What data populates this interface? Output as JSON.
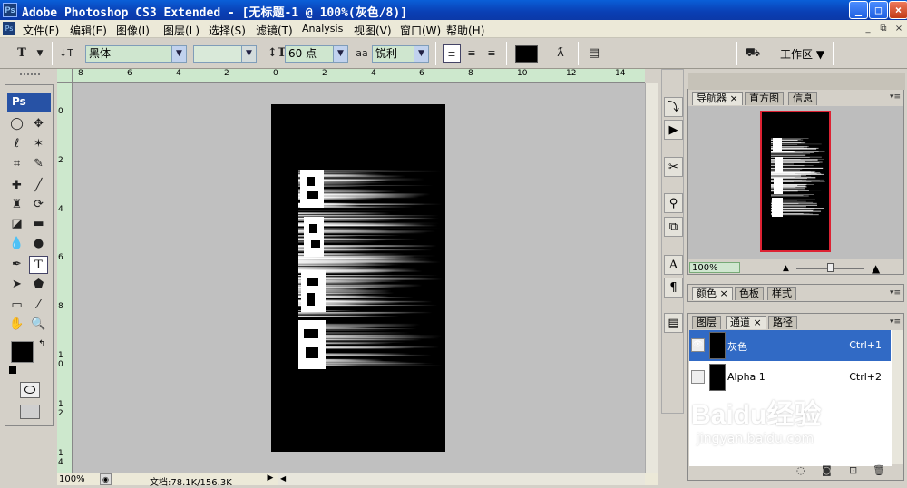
{
  "window": {
    "title": "Adobe Photoshop CS3 Extended - [无标题-1 @ 100%(灰色/8)]",
    "app_icon": "Ps",
    "controls": [
      "_",
      "□",
      "×"
    ]
  },
  "menubar": {
    "items": [
      "文件(F)",
      "编辑(E)",
      "图像(I)",
      "图层(L)",
      "选择(S)",
      "滤镜(T)",
      "Analysis",
      "视图(V)",
      "窗口(W)",
      "帮助(H)"
    ],
    "doc_controls": [
      "_",
      "⧉",
      "×"
    ]
  },
  "options_bar": {
    "font_family": "黑体",
    "font_style": "-",
    "font_size": "60 点",
    "antialias_label": "aa",
    "antialias": "锐利",
    "color_swatch": "#000000",
    "workspace_label": "工作区 ▼"
  },
  "rulers": {
    "top_labels": [
      "8",
      "6",
      "4",
      "2",
      "0",
      "2",
      "4",
      "6",
      "8",
      "10",
      "12",
      "14"
    ],
    "left_labels": [
      "0",
      "2",
      "4",
      "6",
      "8",
      "1 0",
      "1 2",
      "1 4"
    ]
  },
  "status_bar": {
    "zoom": "100%",
    "doc_info": "文档:78.1K/156.3K"
  },
  "toolbox": {
    "logo": "Ps"
  },
  "navigator_panel": {
    "tabs": [
      "导航器 ×",
      "直方图",
      "信息"
    ],
    "zoom": "100%"
  },
  "color_panel": {
    "tabs": [
      "颜色 ×",
      "色板",
      "样式"
    ]
  },
  "channels_panel": {
    "tabs": [
      "图层",
      "通道 ×",
      "路径"
    ],
    "channels": [
      {
        "name": "灰色",
        "shortcut": "Ctrl+1",
        "visible": true,
        "selected": true
      },
      {
        "name": "Alpha 1",
        "shortcut": "Ctrl+2",
        "visible": false,
        "selected": false
      }
    ]
  },
  "watermark": {
    "text": "Baidu经验",
    "url": "jingyan.baidu.com"
  }
}
